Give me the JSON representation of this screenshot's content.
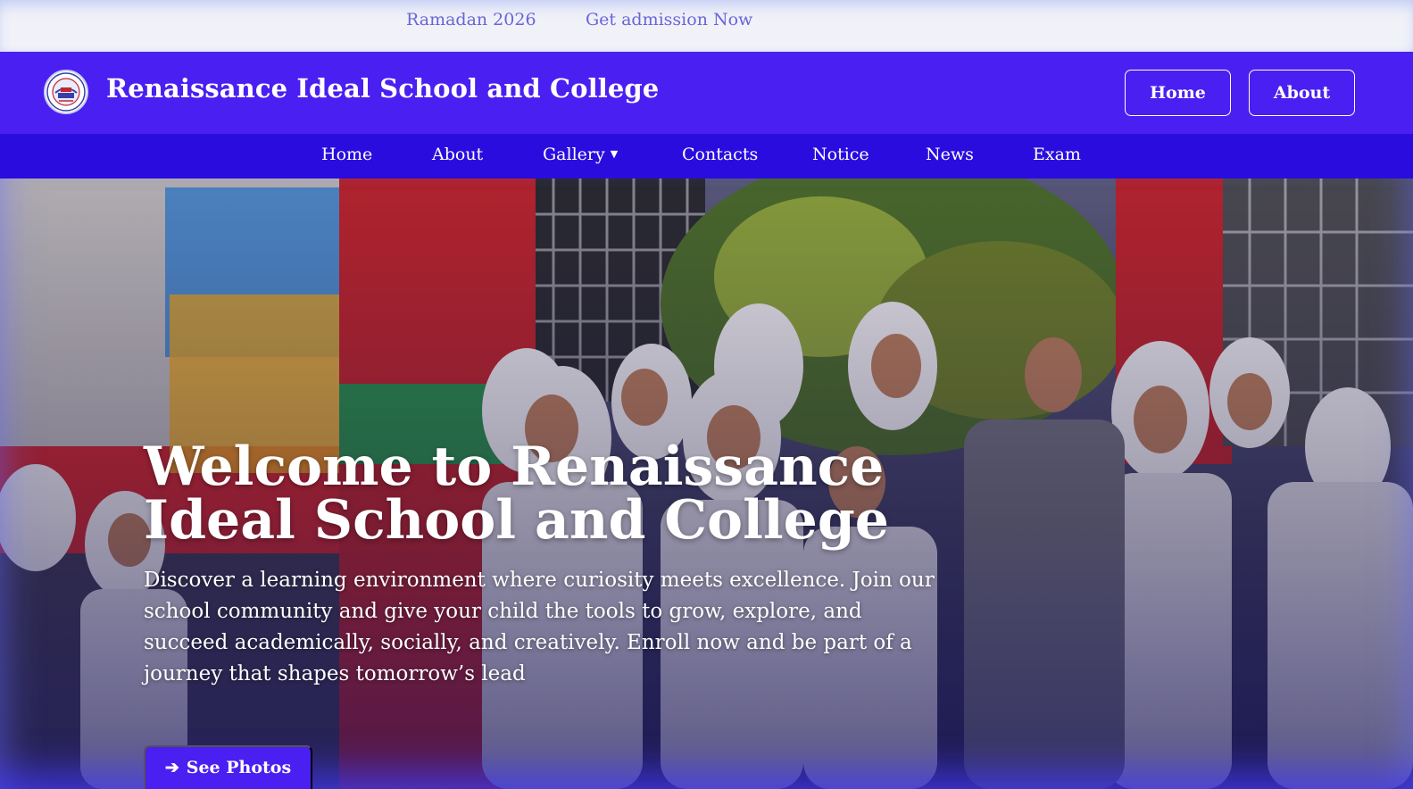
{
  "ticker": {
    "items": [
      "Ramadan 2026",
      "Get admission Now"
    ]
  },
  "header": {
    "title": "Renaissance Ideal School and College",
    "buttons": {
      "home": "Home",
      "about": "About"
    }
  },
  "nav": {
    "items": [
      {
        "label": "Home"
      },
      {
        "label": "About"
      },
      {
        "label": "Gallery",
        "caret": "▼"
      },
      {
        "label": "Contacts"
      },
      {
        "label": "Notice"
      },
      {
        "label": "News"
      },
      {
        "label": "Exam"
      }
    ]
  },
  "hero": {
    "title_line1": "Welcome to Renaissance",
    "title_line2": "Ideal School and College",
    "text": "Discover a learning environment where curiosity meets excellence. Join our school community and give your child the tools to grow, explore, and succeed academically, socially, and creatively. Enroll now and be part of a journey that shapes tomorrow’s lead",
    "cta": {
      "icon": "arrow-right-icon",
      "arrow_glyph": "➔",
      "label": "See Photos"
    }
  },
  "colors": {
    "header_bg": "#4a1ff1",
    "nav_bg": "#2a0cdf",
    "ticker_text": "#6a64d8",
    "topbar_bg": "#f1f2f8"
  }
}
